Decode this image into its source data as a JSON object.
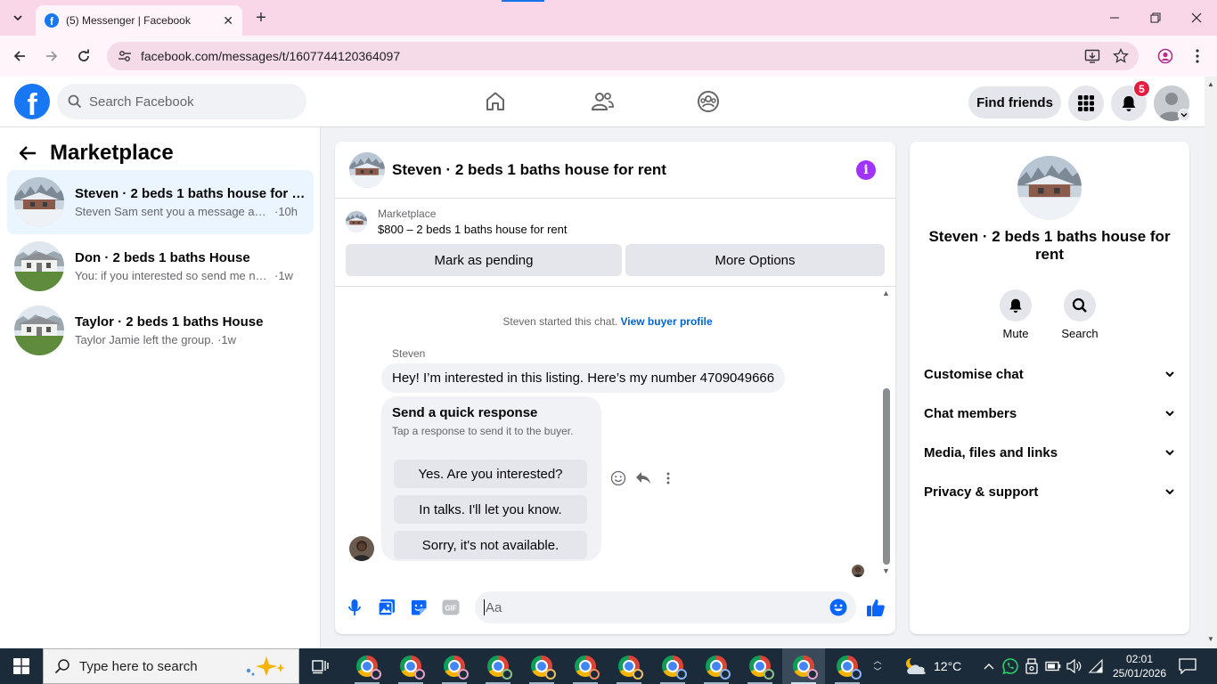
{
  "browser": {
    "tab_title": "(5) Messenger | Facebook",
    "url": "facebook.com/messages/t/1607744120364097"
  },
  "fb": {
    "search_placeholder": "Search Facebook",
    "find_friends": "Find friends",
    "notification_count": "5"
  },
  "sidebar": {
    "title": "Marketplace",
    "conversations": [
      {
        "name": "Steven · 2 beds 1 baths house for r...",
        "preview": "Steven Sam sent you a message abo...",
        "time": "·10h"
      },
      {
        "name": "Don · 2 beds 1 baths House",
        "preview": "You: if you interested so send me nu...",
        "time": "·1w"
      },
      {
        "name": "Taylor · 2 beds 1 baths House",
        "preview": "Taylor Jamie left the group.",
        "time": "·1w"
      }
    ]
  },
  "chat": {
    "title": "Steven · 2 beds 1 baths house for rent",
    "marketplace_label": "Marketplace",
    "listing": "$800 – 2 beds 1 baths house for rent",
    "mark_pending": "Mark as pending",
    "more_options": "More Options",
    "system_message": "Steven started this chat.",
    "view_buyer_profile": "View buyer profile",
    "sender_name": "Steven",
    "message": "Hey! I’m interested in this listing. Here’s my number 4709049666",
    "quick_response_title": "Send a quick response",
    "quick_response_sub": "Tap a response to send it to the buyer.",
    "quick_responses": [
      "Yes. Are you interested?",
      "In talks. I'll let you know.",
      "Sorry, it's not available."
    ],
    "composer_placeholder": "Aa"
  },
  "info_panel": {
    "name": "Steven · 2 beds 1 baths house for rent",
    "mute": "Mute",
    "search": "Search",
    "sections": [
      "Customise chat",
      "Chat members",
      "Media, files and links",
      "Privacy & support"
    ]
  },
  "taskbar": {
    "search_placeholder": "Type here to search",
    "temperature": "12°C",
    "time": "02:01",
    "date": "25/01/2026"
  },
  "colors": {
    "fb_blue": "#1877f2",
    "messenger_purple": "#a033ff",
    "link_blue": "#0064d1",
    "notification_red": "#e41e3f",
    "chrome_tabbar": "#f9d6e8"
  }
}
